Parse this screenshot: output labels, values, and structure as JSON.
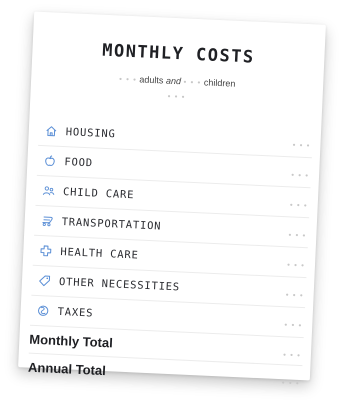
{
  "card": {
    "title": "MONTHLY COSTS",
    "subtitle": {
      "adults_placeholder": "• • •",
      "adults_label": "adults",
      "connector": "and",
      "children_placeholder": "• • •",
      "children_label": "children",
      "extra_placeholder": "• • •"
    },
    "rows": [
      {
        "label": "HOUSING",
        "icon": "home-icon",
        "value": "• • •"
      },
      {
        "label": "FOOD",
        "icon": "apple-icon",
        "value": "• • •"
      },
      {
        "label": "CHILD CARE",
        "icon": "people-icon",
        "value": "• • •"
      },
      {
        "label": "TRANSPORTATION",
        "icon": "bus-icon",
        "value": "• • •"
      },
      {
        "label": "HEALTH CARE",
        "icon": "medical-cross-icon",
        "value": "• • •"
      },
      {
        "label": "OTHER NECESSITIES",
        "icon": "tag-icon",
        "value": "• • •"
      },
      {
        "label": "TAXES",
        "icon": "coins-icon",
        "value": "• • •"
      }
    ],
    "totals": [
      {
        "label": "Monthly Total",
        "value": "• • •"
      },
      {
        "label": "Annual Total",
        "value": "• • •"
      }
    ]
  },
  "colors": {
    "icon": "#5b8fd6",
    "text": "#2a2b30",
    "placeholder": "#c8c8c8"
  }
}
